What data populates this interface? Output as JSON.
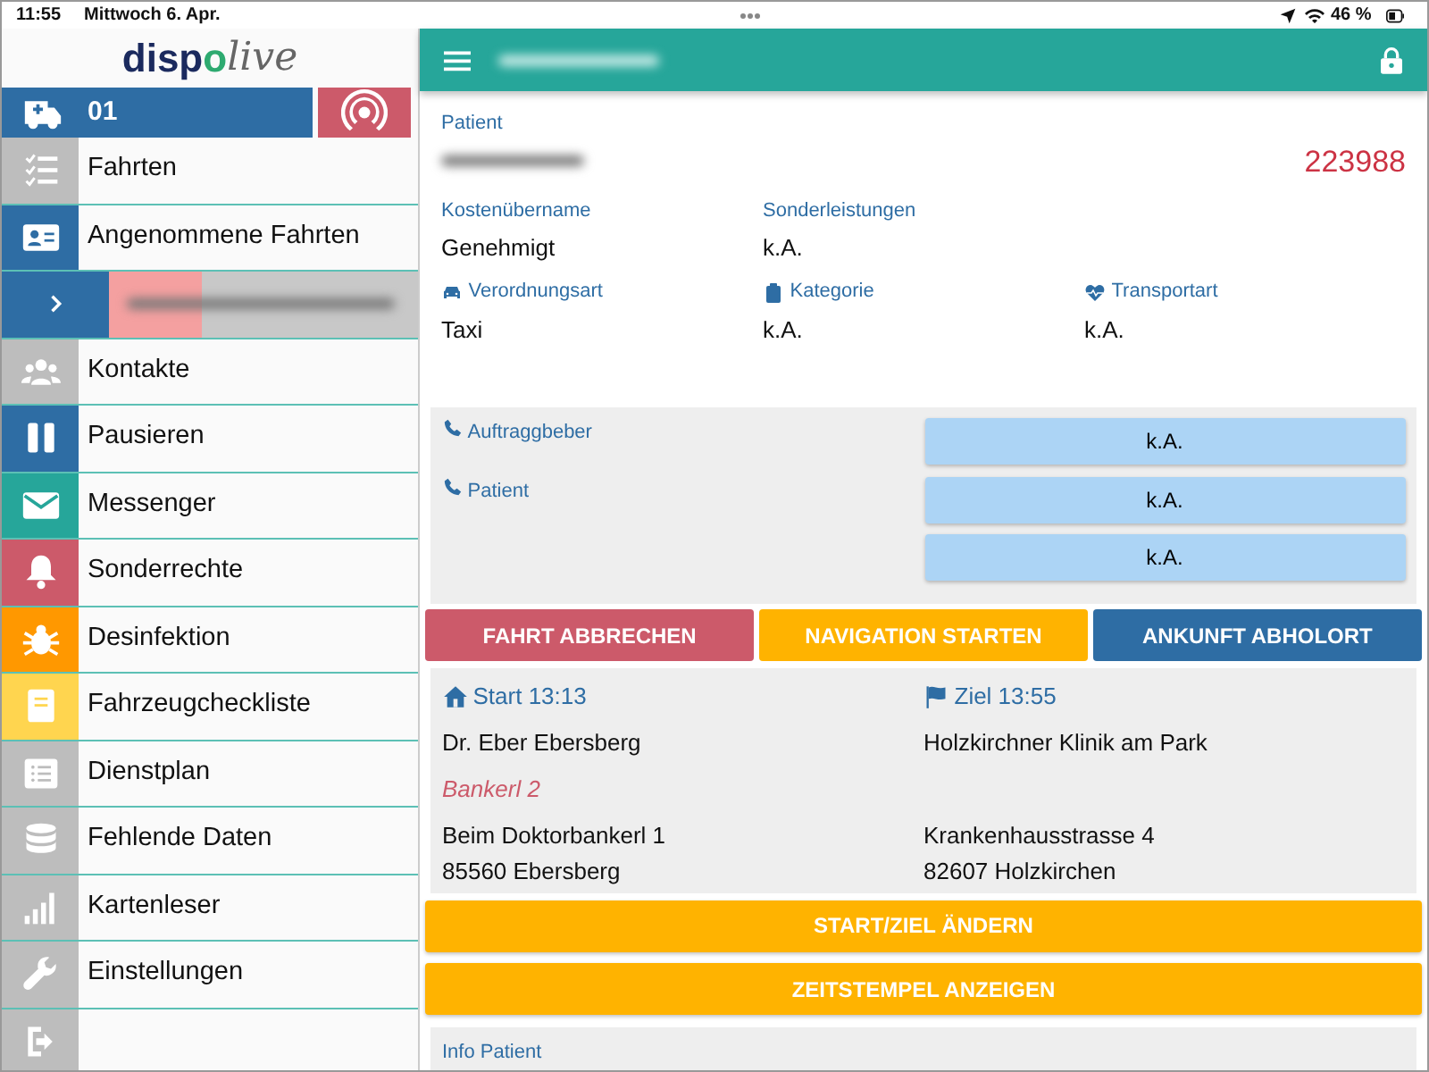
{
  "status_bar": {
    "time": "11:55",
    "date": "Mittwoch 6. Apr.",
    "battery": "46 %"
  },
  "logo": {
    "parts": [
      {
        "kind": "bold",
        "text": "disp"
      },
      {
        "kind": "accent",
        "text": "o"
      },
      {
        "kind": "italic",
        "text": "live"
      }
    ]
  },
  "vehicle": {
    "number": "01"
  },
  "sidebar": {
    "items": [
      {
        "kind": "checklist",
        "label": "Fahrten",
        "color": "#bdbdbd"
      },
      {
        "kind": "idcard",
        "label": "Angenommene Fahrten",
        "color": "#2e6da4"
      },
      {
        "kind": "sub",
        "color": "#2e6da4"
      },
      {
        "kind": "people",
        "label": "Kontakte",
        "color": "#bdbdbd"
      },
      {
        "kind": "pause",
        "label": "Pausieren",
        "color": "#2e6da4"
      },
      {
        "kind": "mail",
        "label": "Messenger",
        "color": "#26a69a"
      },
      {
        "kind": "bell",
        "label": "Sonderrechte",
        "color": "#cc5a6a"
      },
      {
        "kind": "bug",
        "label": "Desinfektion",
        "color": "#ff9800"
      },
      {
        "kind": "book",
        "label": "Fahrzeugcheckliste",
        "color": "#ffd54f"
      },
      {
        "kind": "list",
        "label": "Dienstplan",
        "color": "#bdbdbd"
      },
      {
        "kind": "db",
        "label": "Fehlende Daten",
        "color": "#bdbdbd"
      },
      {
        "kind": "signal",
        "label": "Kartenleser",
        "color": "#bdbdbd"
      },
      {
        "kind": "wrench",
        "label": "Einstellungen",
        "color": "#bdbdbd"
      },
      {
        "kind": "logout",
        "color": "#bdbdbd"
      }
    ]
  },
  "patient": {
    "label": "Patient",
    "order_number": "223988",
    "field_rows": [
      [
        {
          "kind": "plain",
          "label": "Kostenübername",
          "value": "Genehmigt"
        },
        {
          "kind": "plain",
          "label": "Sonderleistungen",
          "value": "k.A."
        }
      ],
      [
        {
          "kind": "car",
          "label": "Verordnungsart",
          "value": "Taxi"
        },
        {
          "kind": "clipboard",
          "label": "Kategorie",
          "value": "k.A."
        },
        {
          "kind": "heart",
          "label": "Transportart",
          "value": "k.A."
        }
      ]
    ]
  },
  "contacts": [
    {
      "label": "Auftraggbeber",
      "numbers": [
        "k.A."
      ]
    },
    {
      "label": "Patient",
      "numbers": [
        "k.A.",
        "k.A."
      ]
    }
  ],
  "actions": [
    {
      "kind": "danger",
      "label": "FAHRT ABBRECHEN"
    },
    {
      "kind": "warning",
      "label": "NAVIGATION STARTEN"
    },
    {
      "kind": "primary",
      "label": "ANKUNFT ABHOLORT"
    }
  ],
  "route": [
    {
      "kind": "home",
      "title": "Start 13:13",
      "name": "Dr. Eber Ebersberg",
      "note": "Bankerl 2",
      "lines": [
        "Beim Doktorbankerl 1",
        "85560 Ebersberg"
      ]
    },
    {
      "kind": "flag",
      "title": "Ziel 13:55",
      "name": "Holzkirchner Klinik am Park",
      "lines": [
        "Krankenhausstrasse 4",
        "82607 Holzkirchen"
      ]
    }
  ],
  "wide_buttons": [
    "START/ZIEL ÄNDERN",
    "ZEITSTEMPEL ANZEIGEN"
  ],
  "info": {
    "label": "Info Patient"
  }
}
